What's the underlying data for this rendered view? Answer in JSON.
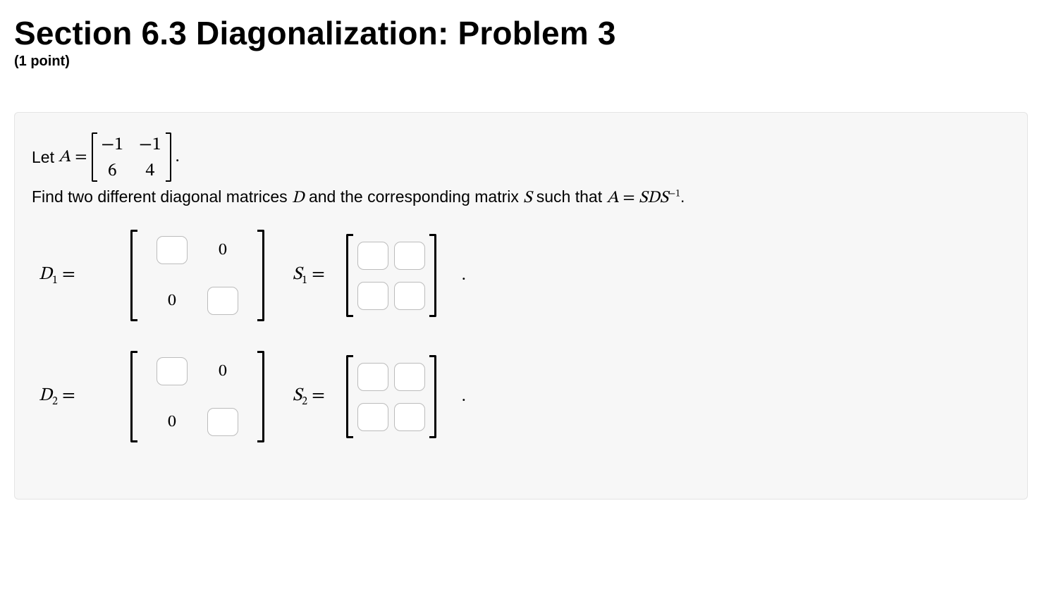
{
  "title": "Section 6.3 Diagonalization: Problem 3",
  "points": "(1 point)",
  "problem": {
    "let_prefix": "Let ",
    "A_var": "A",
    "equals": " = ",
    "A_matrix": {
      "r1c1": "−1",
      "r1c2": "−1",
      "r2c1": "6",
      "r2c2": "4"
    },
    "after_matrix": ".",
    "instruction_pre": "Find two different diagonal matrices ",
    "D_var": "D",
    "instruction_mid": " and the corresponding matrix ",
    "S_var": "S",
    "instruction_post": " such that ",
    "equation_lhs": "A",
    "equation_eq": " = ",
    "equation_rhs": "SDS",
    "equation_exp": "−1",
    "instruction_end": "."
  },
  "answers": {
    "D1_label_var": "D",
    "D1_label_sub": "1",
    "S1_label_var": "S",
    "S1_label_sub": "1",
    "D2_label_var": "D",
    "D2_label_sub": "2",
    "S2_label_var": "S",
    "S2_label_sub": "2",
    "zero": "0",
    "period": ".",
    "D1": {
      "d11": "",
      "d22": ""
    },
    "S1": {
      "s11": "",
      "s12": "",
      "s21": "",
      "s22": ""
    },
    "D2": {
      "d11": "",
      "d22": ""
    },
    "S2": {
      "s11": "",
      "s12": "",
      "s21": "",
      "s22": ""
    }
  }
}
